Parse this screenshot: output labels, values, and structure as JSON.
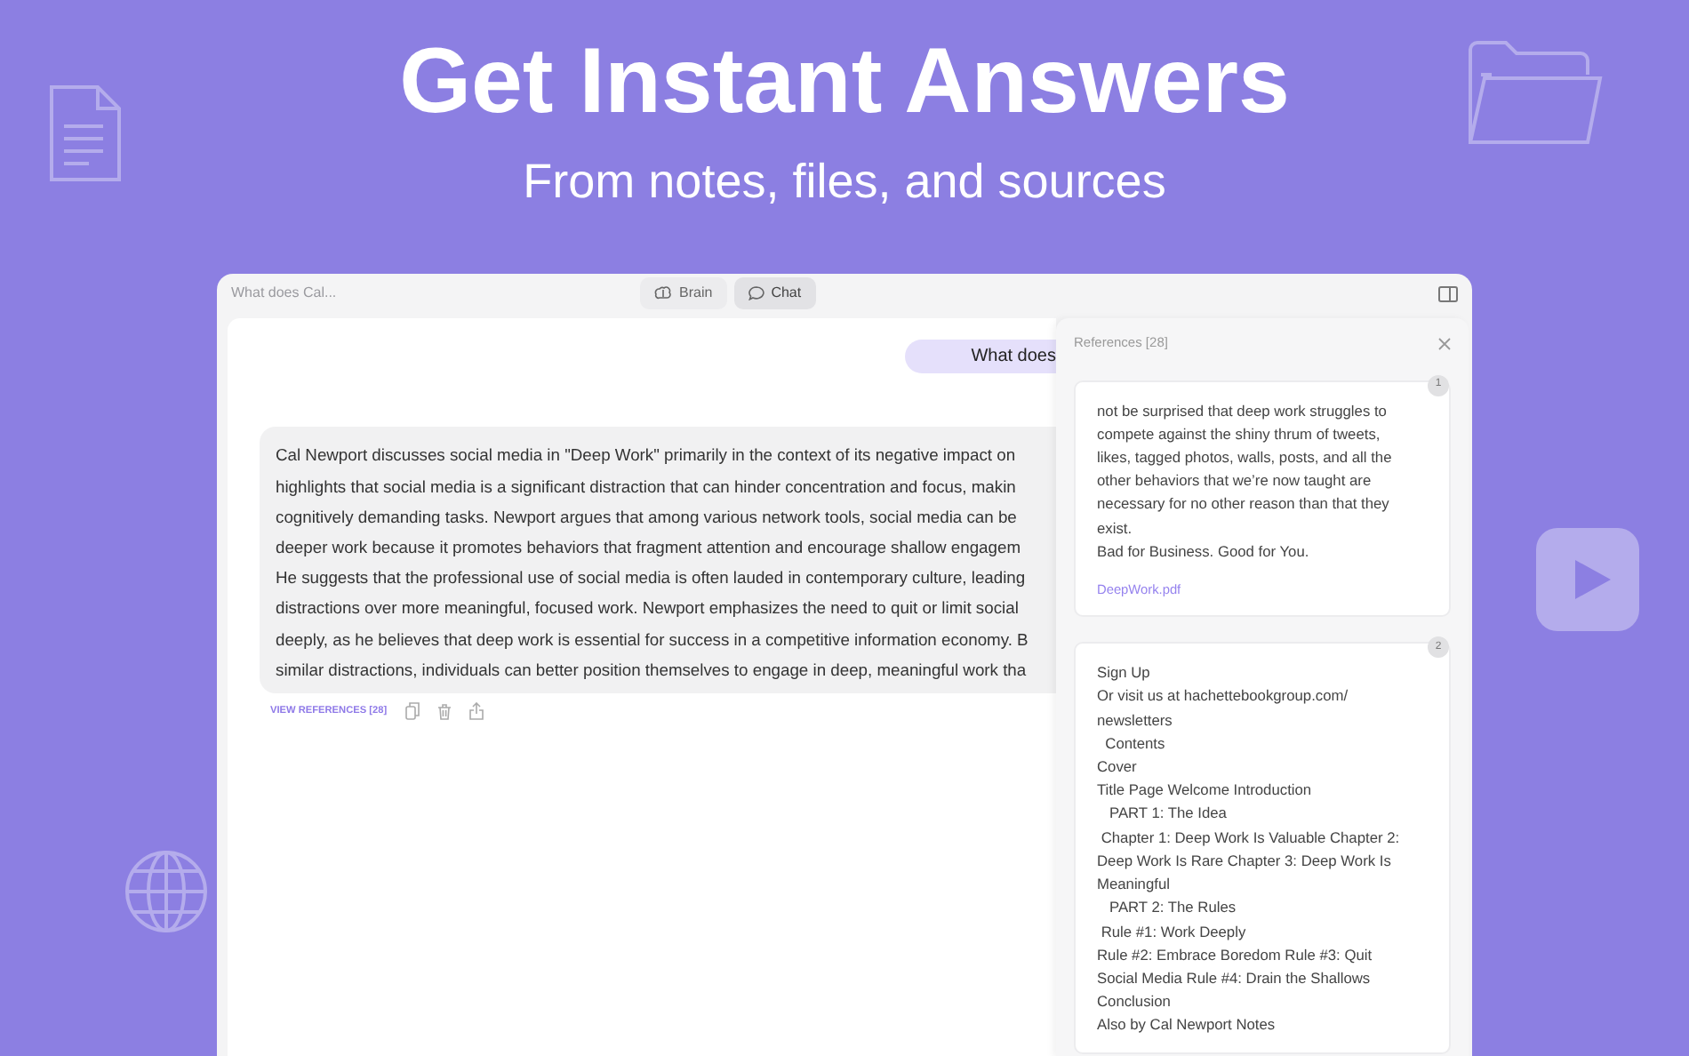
{
  "hero": {
    "title": "Get Instant Answers",
    "subtitle": "From notes, files, and sources"
  },
  "window": {
    "title": "What does Cal...",
    "tabs": [
      {
        "label": "Brain",
        "selected": false,
        "kind": "brain"
      },
      {
        "label": "Chat",
        "selected": true,
        "kind": "chat"
      }
    ]
  },
  "chat": {
    "question": "What does",
    "answer_lines": [
      "Cal Newport discusses social media in \"Deep Work\" primarily in the context of its negative impact on",
      "highlights that social media is a significant distraction that can hinder concentration and focus, makin",
      "cognitively demanding tasks. Newport argues that among various network tools, social media can be",
      "deeper work because it promotes behaviors that fragment attention and encourage shallow engagem",
      "He suggests that the professional use of social media is often lauded in contemporary culture, leading",
      "distractions over more meaningful, focused work. Newport emphasizes the need to quit or limit social",
      "deeply, as he believes that deep work is essential for success in a competitive information economy. B",
      "similar distractions, individuals can better position themselves to engage in deep, meaningful work tha"
    ],
    "view_references": "VIEW REFERENCES [28]"
  },
  "references": {
    "title": "References [28]",
    "items": [
      {
        "number": "1",
        "lines": [
          "not be surprised that deep work struggles to compete against the shiny thrum of tweets, likes, tagged photos, walls, posts, and all the other behaviors that we’re now taught are necessary for no other reason than that they exist.",
          "Bad for Business. Good for You."
        ],
        "source": "DeepWork.pdf"
      },
      {
        "number": "2",
        "lines": [
          "Sign Up",
          "Or visit us at hachettebookgroup.com/ newsletters",
          "  Contents",
          "Cover",
          "Title Page Welcome Introduction",
          "   PART 1: The Idea",
          " Chapter 1: Deep Work Is Valuable Chapter 2: Deep Work Is Rare Chapter 3: Deep Work Is Meaningful",
          "   PART 2: The Rules",
          " Rule #1: Work Deeply",
          "Rule #2: Embrace Boredom Rule #3: Quit Social Media Rule #4: Drain the Shallows",
          "Conclusion",
          "Also by Cal Newport Notes"
        ]
      }
    ]
  }
}
